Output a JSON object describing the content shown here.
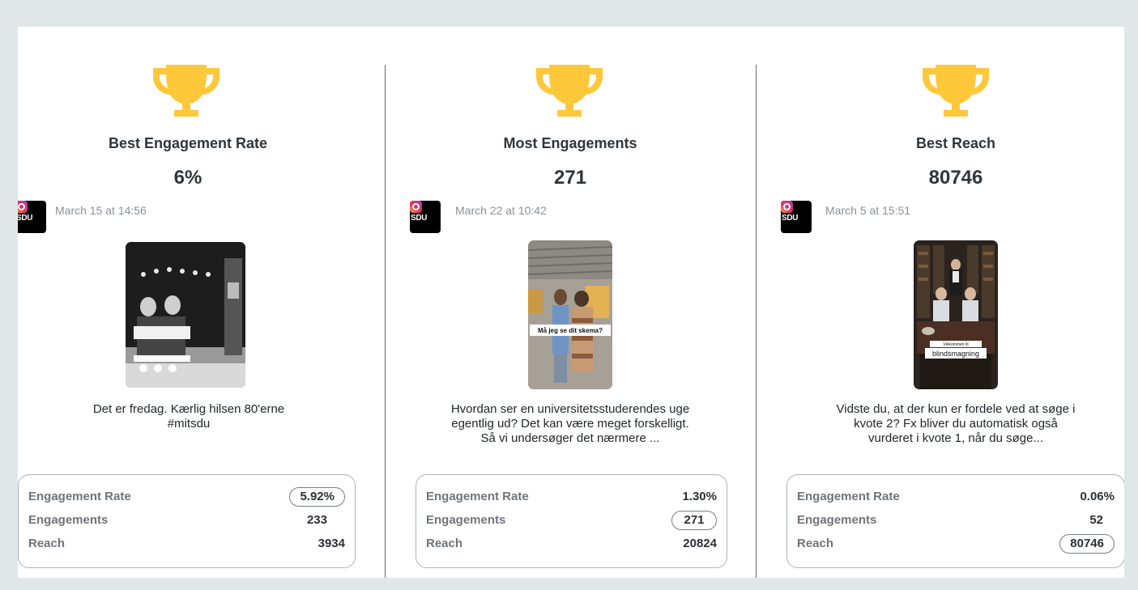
{
  "cards": [
    {
      "title": "Best Engagement Rate",
      "value": "6%",
      "date": "March 15 at 14:56",
      "avatar_text": "SDU",
      "thumb_text": "JL dilne",
      "caption": "Det er fredag. Kærlig hilsen 80'erne #mitsdu",
      "stats": [
        {
          "label": "Engagement Rate",
          "value": "5.92%",
          "highlighted": true
        },
        {
          "label": "Engagements",
          "value": "233",
          "highlighted": false
        },
        {
          "label": "Reach",
          "value": "3934",
          "highlighted": false
        }
      ]
    },
    {
      "title": "Most Engagements",
      "value": "271",
      "date": "March 22 at 10:42",
      "avatar_text": "SDU",
      "thumb_text": "Må jeg se dit skema?",
      "caption": "Hvordan ser en universitetsstuderendes uge egentlig ud? Det kan være meget forskelligt. Så vi undersøger det nærmere ...",
      "stats": [
        {
          "label": "Engagement Rate",
          "value": "1.30%",
          "highlighted": false
        },
        {
          "label": "Engagements",
          "value": "271",
          "highlighted": true
        },
        {
          "label": "Reach",
          "value": "20824",
          "highlighted": false
        }
      ]
    },
    {
      "title": "Best Reach",
      "value": "80746",
      "date": "March 5 at 15:51",
      "avatar_text": "SDU",
      "thumb_text_small": "Velkommen til",
      "thumb_text": "blindsmagning",
      "caption": "Vidste du, at der kun er fordele ved at søge i kvote 2? Fx bliver du automatisk også vurderet i kvote 1, når du søge...",
      "stats": [
        {
          "label": "Engagement Rate",
          "value": "0.06%",
          "highlighted": false
        },
        {
          "label": "Engagements",
          "value": "52",
          "highlighted": false
        },
        {
          "label": "Reach",
          "value": "80746",
          "highlighted": true
        }
      ]
    }
  ],
  "colors": {
    "trophy": "#ffc83a",
    "background": "#e1e6e9",
    "panel": "#ffffff"
  },
  "icons": {
    "trophy": "trophy-icon",
    "instagram": "instagram-icon"
  }
}
